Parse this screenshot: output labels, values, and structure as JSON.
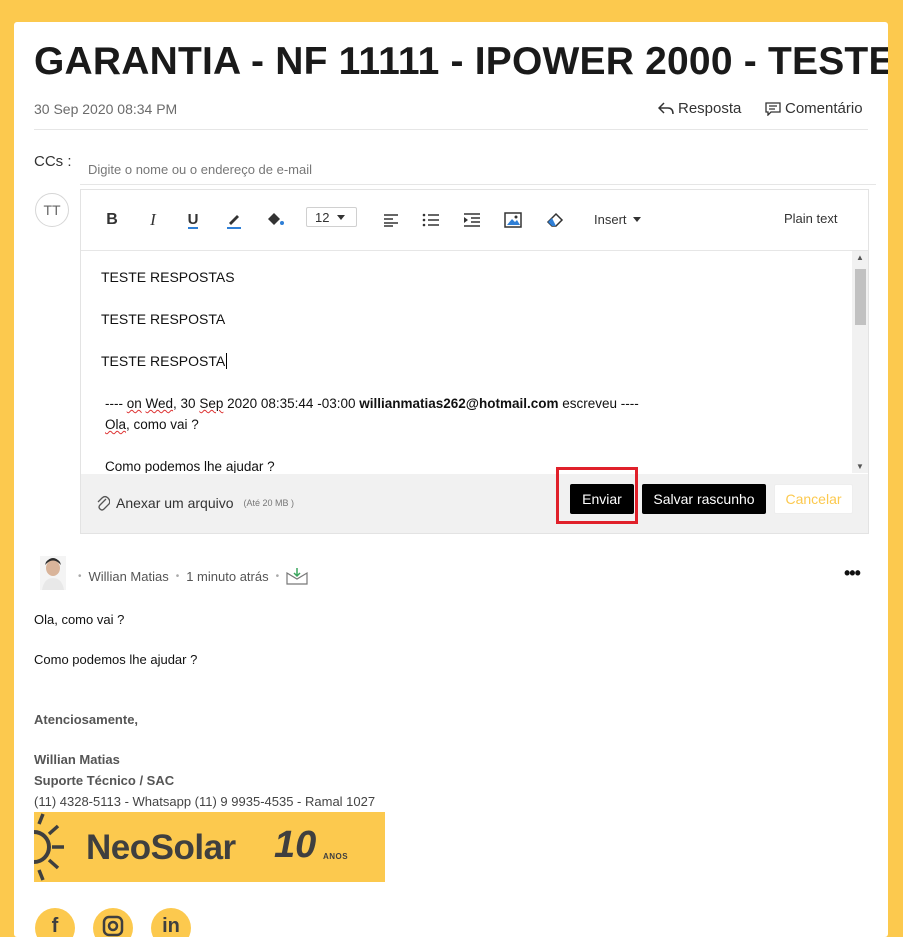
{
  "ticket": {
    "title": "GARANTIA - NF 11111 - IPOWER 2000 - TESTE",
    "date": "30 Sep 2020 08:34 PM",
    "reply_label": "Resposta",
    "comment_label": "Comentário"
  },
  "cc": {
    "label": "CCs :",
    "placeholder": "Digite o nome ou o endereço de e-mail"
  },
  "composer": {
    "avatar_initials": "TT",
    "toolbar": {
      "bold": "B",
      "italic": "I",
      "underline": "U",
      "font_size": "12",
      "insert_label": "Insert",
      "plain_text_label": "Plain text"
    },
    "lines": [
      "TESTE RESPOSTAS",
      "TESTE RESPOSTA",
      "TESTE RESPOSTA"
    ],
    "quote": {
      "prefix": "---- ",
      "on": "on",
      "wed": "Wed",
      "day": ", 30 ",
      "sep": "Sep",
      "rest": " 2020 08:35:44 -03:00 ",
      "email": "willianmatias262@hotmail.com",
      "suffix": "  escreveu ----",
      "line1_ola": "Ola",
      "line1_rest": ", como vai ?",
      "line2": "Como podemos lhe ajudar ?"
    },
    "attach_label": "Anexar um arquivo",
    "attach_limit": "(Até 20 MB )",
    "send_label": "Enviar",
    "draft_label": "Salvar rascunho",
    "cancel_label": "Cancelar"
  },
  "message": {
    "author": "Willian Matias",
    "time": "1 minuto atrás",
    "line1": "Ola, como vai ?",
    "line2": "Como podemos lhe ajudar ?",
    "regards": "Atenciosamente,",
    "sig_name": "Willian Matias",
    "sig_role": "Suporte Técnico / SAC",
    "sig_phone": "(11) 4328-5113 - Whatsapp (11) 9 9935-4535 - Ramal 1027",
    "banner": {
      "brand": "NeoSolar",
      "years": "10",
      "anos": "ANOS"
    },
    "social": [
      "f",
      "ig",
      "in"
    ]
  },
  "colors": {
    "background": "#fcc94e",
    "button_dark": "#000000",
    "highlight": "#e0202a",
    "brand_text": "#3f3f3f"
  }
}
